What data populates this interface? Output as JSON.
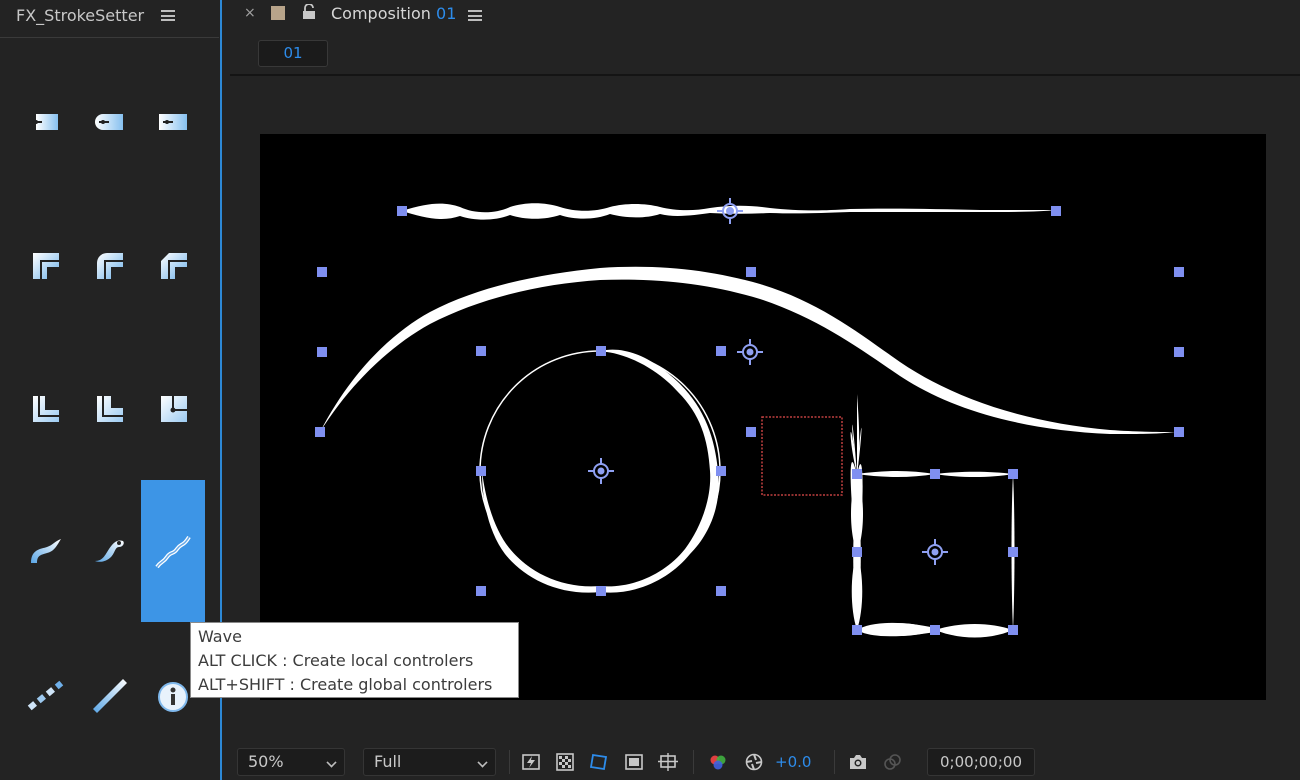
{
  "left_panel": {
    "title": "FX_StrokeSetter",
    "tools": [
      {
        "name": "cap-butt",
        "row": 0,
        "col": 0
      },
      {
        "name": "cap-round",
        "row": 0,
        "col": 1
      },
      {
        "name": "cap-square",
        "row": 0,
        "col": 2
      },
      {
        "name": "join-miter",
        "row": 1,
        "col": 0
      },
      {
        "name": "join-round",
        "row": 1,
        "col": 1
      },
      {
        "name": "join-bevel",
        "row": 1,
        "col": 2
      },
      {
        "name": "corner-a",
        "row": 2,
        "col": 0
      },
      {
        "name": "corner-b",
        "row": 2,
        "col": 1
      },
      {
        "name": "corner-c",
        "row": 2,
        "col": 2
      },
      {
        "name": "taper",
        "row": 3,
        "col": 0
      },
      {
        "name": "taper-both",
        "row": 3,
        "col": 1
      },
      {
        "name": "wave",
        "row": 3,
        "col": 2,
        "active": true
      },
      {
        "name": "dashes",
        "row": 4,
        "col": 0
      },
      {
        "name": "line",
        "row": 4,
        "col": 1
      },
      {
        "name": "info",
        "row": 4,
        "col": 2
      }
    ],
    "tooltip": {
      "line1": "Wave",
      "line2": "ALT CLICK : Create local controlers",
      "line3": "ALT+SHIFT : Create global controlers"
    }
  },
  "composition": {
    "tab_prefix": "Composition ",
    "tab_number": "01",
    "close_glyph": "×",
    "subtab_label": "01"
  },
  "toolbar": {
    "zoom": "50%",
    "resolution": "Full",
    "exposure": "+0.0",
    "timecode": "0;00;00;00"
  },
  "colors": {
    "accent": "#2d8ceb",
    "active_tool": "#3d95e6",
    "handle": "#7f8ff0",
    "selection_box": "#c04040"
  }
}
